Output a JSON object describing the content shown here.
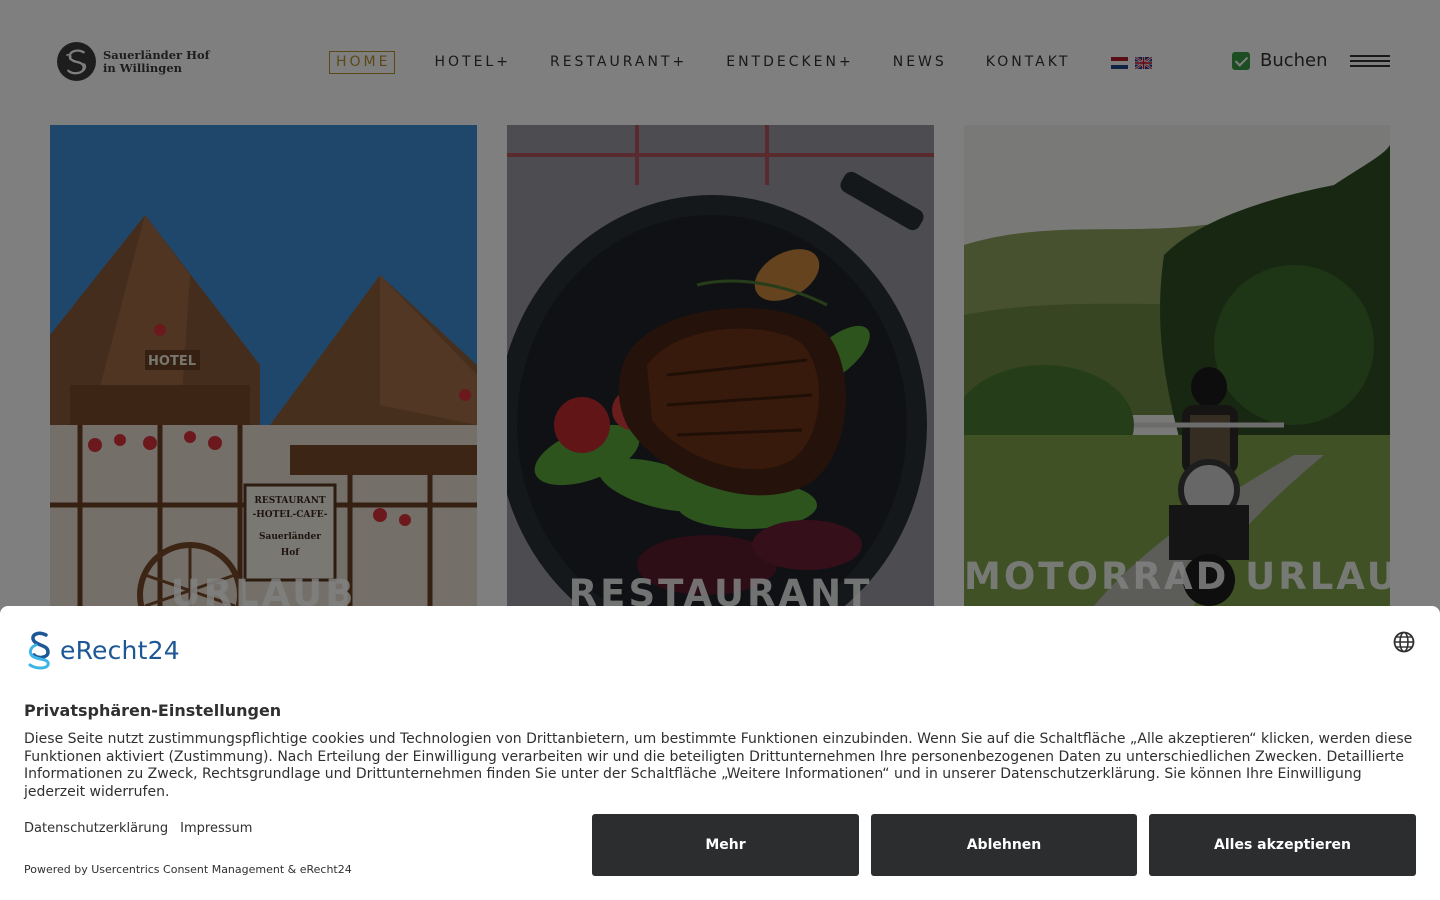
{
  "header": {
    "logo": {
      "line1": "Sauerländer Hof",
      "line2": "in Willingen"
    },
    "nav": [
      {
        "label": "HOME",
        "active": true
      },
      {
        "label": "HOTEL+"
      },
      {
        "label": "RESTAURANT+"
      },
      {
        "label": "ENTDECKEN+"
      },
      {
        "label": "NEWS"
      },
      {
        "label": "KONTAKT"
      }
    ],
    "flags": [
      "flag-netherlands-icon",
      "flag-uk-icon"
    ],
    "book_label": "Buchen",
    "book_icon": "check-square-icon",
    "menu_icon": "hamburger-menu-icon",
    "accent_color": "#b5922f"
  },
  "tiles": [
    {
      "title": "URLAUB",
      "image": "hotel-facade-photo"
    },
    {
      "title": "RESTAURANT",
      "image": "steak-dish-photo"
    },
    {
      "title": "MOTORRAD URLAUB",
      "image": "motorcycle-rider-photo"
    }
  ],
  "consent": {
    "brand": "eRecht24",
    "globe_icon": "globe-icon",
    "title": "Privatsphären-Einstellungen",
    "text": "Diese Seite nutzt zustimmungspflichtige cookies und Technologien von Drittanbietern, um bestimmte Funktionen einzubinden. Wenn Sie auf die Schaltfläche „Alle akzeptieren“ klicken, werden diese Funktionen aktiviert (Zustimmung). Nach Erteilung der Einwilligung verarbeiten wir und die beteiligten Drittunternehmen Ihre personenbezogenen Daten zu unterschiedlichen Zwecken. Detaillierte Informationen zu Zweck, Rechtsgrundlage und Drittunternehmen finden Sie unter der Schaltfläche „Weitere Informationen“ und in unserer Datenschutzerklärung. Sie können Ihre Einwilligung jederzeit widerrufen.",
    "link_privacy": "Datenschutzerklärung",
    "link_imprint": "Impressum",
    "powered_by": "Powered by Usercentrics Consent Management & eRecht24",
    "btn_more": "Mehr",
    "btn_decline": "Ablehnen",
    "btn_accept": "Alles akzeptieren",
    "brand_color": "#1d5796",
    "button_color": "#2b2d2f"
  }
}
